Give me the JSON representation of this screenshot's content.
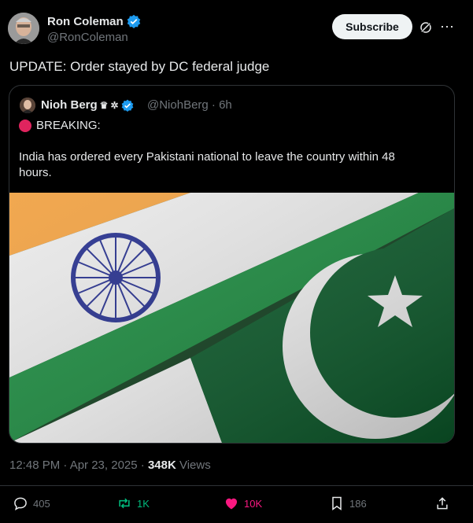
{
  "author": {
    "name": "Ron Coleman",
    "handle": "@RonColeman"
  },
  "subscribe_label": "Subscribe",
  "post_text": "UPDATE: Order stayed by DC federal judge",
  "quote": {
    "name": "Nioh Berg",
    "handle_time": "@NiohBerg · 6h",
    "breaking": "BREAKING:",
    "body": "India has ordered every Pakistani national to leave the country within 48 hours."
  },
  "meta": {
    "time": "12:48 PM · Apr 23, 2025 · ",
    "views_count": "348K",
    "views_label": " Views"
  },
  "actions": {
    "replies": "405",
    "reposts": "1K",
    "likes": "10K",
    "bookmarks": "186"
  },
  "colors": {
    "repost": "#00ba7c",
    "like": "#f91880",
    "verified": "#1d9bf0"
  }
}
